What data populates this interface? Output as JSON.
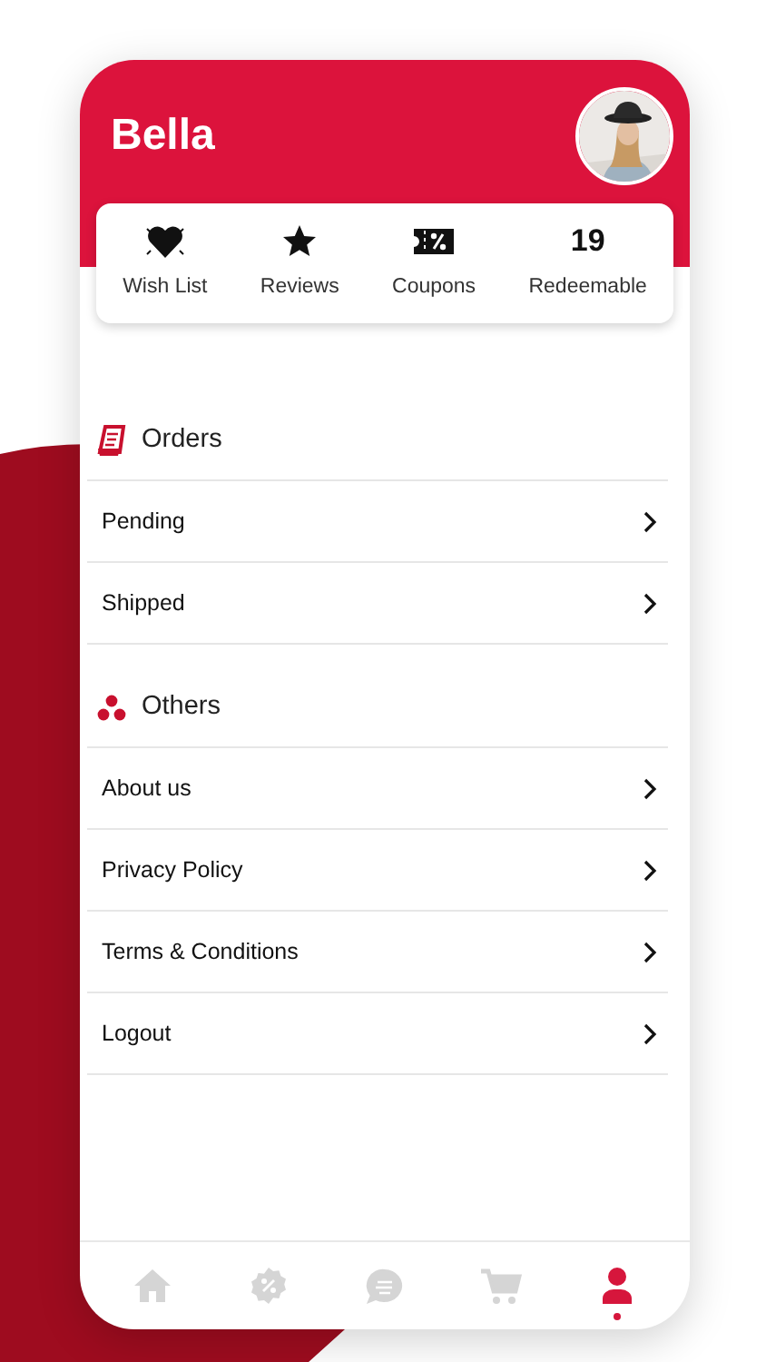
{
  "profile": {
    "name": "Bella"
  },
  "stats": [
    {
      "kind": "heart",
      "label": "Wish List"
    },
    {
      "kind": "star",
      "label": "Reviews"
    },
    {
      "kind": "coupon",
      "label": "Coupons"
    },
    {
      "kind": "number",
      "value": "19",
      "label": "Redeemable"
    }
  ],
  "sections": [
    {
      "kind": "receipt",
      "title": "Orders",
      "items": [
        "Pending",
        "Shipped"
      ]
    },
    {
      "kind": "dots",
      "title": "Others",
      "items": [
        "About us",
        "Privacy Policy",
        "Terms & Conditions",
        "Logout"
      ]
    }
  ],
  "bottom_nav": [
    {
      "kind": "home",
      "selected": false
    },
    {
      "kind": "discount",
      "selected": false
    },
    {
      "kind": "chat",
      "selected": false
    },
    {
      "kind": "cart",
      "selected": false
    },
    {
      "kind": "profile",
      "selected": true
    }
  ]
}
